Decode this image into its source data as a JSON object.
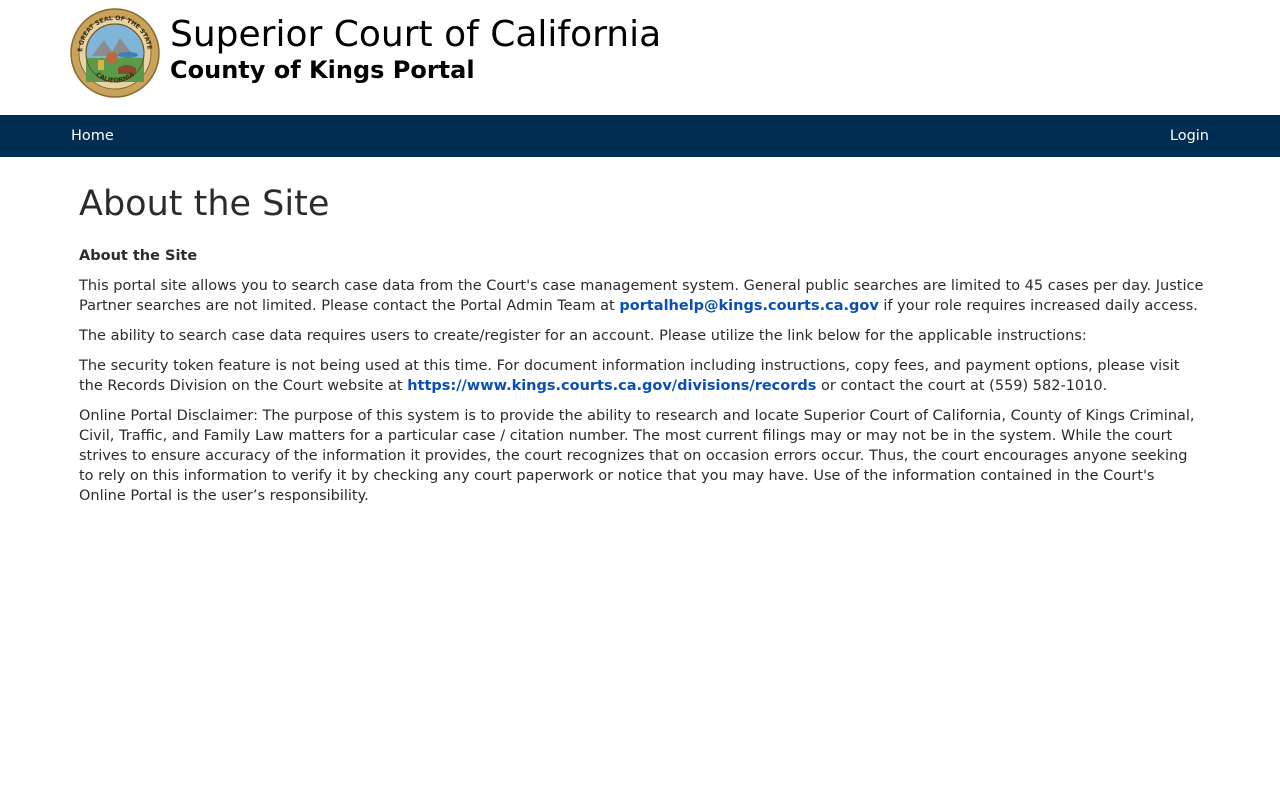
{
  "header": {
    "seal_icon": "california-state-seal",
    "seal_text_top": "THE GREAT SEAL OF THE STATE OF",
    "seal_text_bottom": "CALIFORNIA",
    "title": "Superior Court of California",
    "subtitle": "County of Kings Portal"
  },
  "nav": {
    "home_label": "Home",
    "login_label": "Login"
  },
  "colors": {
    "navbar": "#002e52",
    "link": "#0b4fb5",
    "text": "#2b2b2b"
  },
  "main": {
    "page_title": "About the Site",
    "section_heading": "About the Site",
    "p1_text_a": "This portal site allows you to search case data from the Court's case management system. General public searches are limited to 45 cases per day. Justice Partner searches are not limited. Please contact the Portal Admin Team at ",
    "p1_link": "portalhelp@kings.courts.ca.gov",
    "p1_text_b": " if your role requires increased daily access.",
    "p2_text": "The ability to search case data requires users to create/register for an account. Please utilize the link below for the applicable instructions:",
    "p3_text_a": "The security token feature is not being used at this time. For document information including instructions, copy fees, and payment options, please visit the Records Division on the Court website at ",
    "p3_link": "https://www.kings.courts.ca.gov/divisions/records",
    "p3_text_b": " or contact the court at (559) 582-1010.",
    "p4_text": "Online Portal Disclaimer: The purpose of this system is to provide the ability to research and locate Superior Court of California, County of Kings Criminal, Civil, Traffic, and Family Law matters for a particular case / citation number. The most current filings may or may not be in the system. While the court strives to ensure accuracy of the information it provides, the court recognizes that on occasion errors occur. Thus, the court encourages anyone seeking to rely on this information to verify it by checking any court paperwork or notice that you may have. Use of the information contained in the Court's Online Portal is the user’s responsibility."
  }
}
